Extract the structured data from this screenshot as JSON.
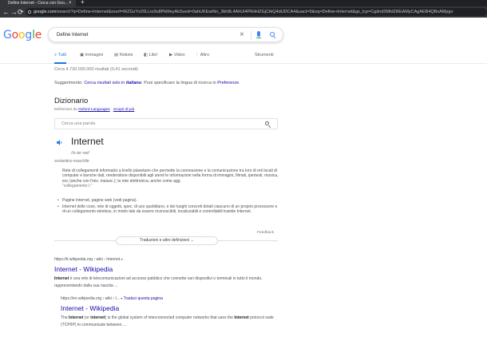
{
  "browser": {
    "tab_title": "Define Internet - Cerca con Goo...",
    "tab_close": "×",
    "new_tab": "+",
    "back": "←",
    "forward": "→",
    "reload": "⟳",
    "url_domain": "google.com",
    "url_rest": "/search?q=Define+Internet&sxsrf=WZGzYx20LLio9u8PkMeyAkSved=0ahUKEwiNn_3kh8L4AhUl4P6HHZGjCtkQ4dUDCA4&uact=5&oq=Define+Internet&gs_lcp=Cgdnd3Mtd2l6EAMyCAgAEB4QBxAMpgo"
  },
  "search": {
    "logo": "Google",
    "query": "Define Internet",
    "clear": "×"
  },
  "tabs": [
    {
      "icon": "⌕",
      "label": "Tutti"
    },
    {
      "icon": "▣",
      "label": "Immagini"
    },
    {
      "icon": "▤",
      "label": "Notizie"
    },
    {
      "icon": "◧",
      "label": "Libri"
    },
    {
      "icon": "▶",
      "label": "Video"
    },
    {
      "icon": "⋮",
      "label": "Altro"
    }
  ],
  "tools_label": "Strumenti",
  "stats": "Circa 4.730.000.000 risultati (0,41 secondi)",
  "suggestion": {
    "prefix": "Suggerimento:",
    "link1": "Cerca risultati solo in",
    "lang": "italiano",
    "mid": ". Puoi specificare la lingua di ricerca in",
    "link2": "Preferenze",
    "end": "."
  },
  "dictionary": {
    "title": "Dizionario",
    "sub_prefix": "Definizioni da",
    "sub_link": "Oxford Languages",
    "sub_sep": " · ",
    "sub_more": "Scopri di più",
    "search_placeholder": "Cerca una parola",
    "word": "Internet",
    "phonetic": "/ìn·ter·net/",
    "pos": "sostantivo maschile",
    "def1": "Rete di collegamenti informatici a livello planetario che permette la connessione e la comunicazione tra loro di reti locali di computer e banche dati, rendendone disponibili agli utenti le informazioni nella forma di immagini, filmati, ipertesti, musica, ecc (anche con l'iniz. maiusc.); la rete elettronica; anche come agg.",
    "def1_example": "\"collegamento I.\"",
    "bullet1": "Pagine Internet, pagine web (vedi pagina).",
    "bullet2": "Internet delle cose, rete di oggetti, spec. di uso quotidiano, e dei luoghi concreti dotati ciascuno di un proprio processore e di un collegamento wireless, in modo tale da essere riconoscibili, localizzabili e controllabili tramite Internet.",
    "feedback": "Feedback",
    "more_button": "Traduzioni e altre definizioni"
  },
  "results": [
    {
      "cite": "https://it.wikipedia.org › wiki › Internet",
      "title": "Internet - Wikipedia",
      "snippet_bold": "Internet",
      "snippet": " è una rete di telecomunicazioni ad accesso pubblico che connette vari dispositivi o terminali in tutto il mondo, rappresentando dalla sua nascita ..."
    },
    {
      "cite": "https://en.wikipedia.org › wiki › I...",
      "translate": "Traduci questa pagina",
      "title": "Internet - Wikipedia",
      "snippet_a": "The ",
      "snippet_b1": "Internet",
      "snippet_c": " (or ",
      "snippet_b2": "internet",
      "snippet_d": ") is the global system of interconnected computer networks that uses the ",
      "snippet_b3": "Internet",
      "snippet_e": " protocol suite (TCP/IP) to communicate between ..."
    }
  ],
  "colors": {
    "link": "#1a0dab",
    "accent": "#1a73e8",
    "text": "#202124",
    "muted": "#70757a"
  }
}
